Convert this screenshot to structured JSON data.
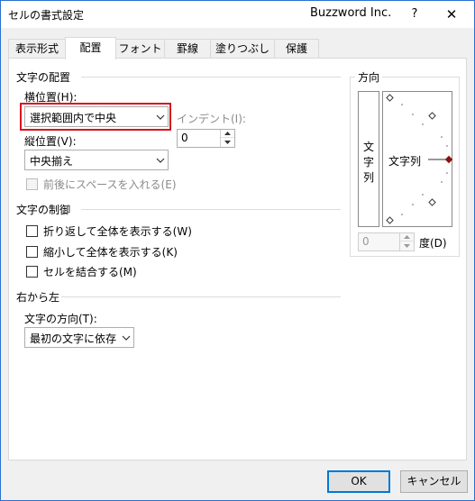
{
  "window": {
    "title": "セルの書式設定",
    "brand": "Buzzword Inc.",
    "help_label": "?",
    "close_label": "✕"
  },
  "tabs": [
    {
      "label": "表示形式",
      "active": false
    },
    {
      "label": "配置",
      "active": true
    },
    {
      "label": "フォント",
      "active": false
    },
    {
      "label": "罫線",
      "active": false
    },
    {
      "label": "塗りつぶし",
      "active": false
    },
    {
      "label": "保護",
      "active": false
    }
  ],
  "text_alignment": {
    "group_label": "文字の配置",
    "horizontal_label": "横位置(H):",
    "horizontal_value": "選択範囲内で中央",
    "indent_label": "インデント(I):",
    "indent_value": "0",
    "vertical_label": "縦位置(V):",
    "vertical_value": "中央揃え",
    "justify_distributed_label": "前後にスペースを入れる(E)"
  },
  "text_control": {
    "group_label": "文字の制御",
    "wrap_text_label": "折り返して全体を表示する(W)",
    "shrink_to_fit_label": "縮小して全体を表示する(K)",
    "merge_cells_label": "セルを結合する(M)"
  },
  "right_to_left": {
    "group_label": "右から左",
    "direction_label": "文字の方向(T):",
    "direction_value": "最初の文字に依存"
  },
  "orientation": {
    "group_label": "方向",
    "vertical_text_chars": [
      "文",
      "字",
      "列"
    ],
    "dial_text": "文字列",
    "degrees_value": "0",
    "degrees_label": "度(D)"
  },
  "footer": {
    "ok_label": "OK",
    "cancel_label": "キャンセル"
  },
  "colors": {
    "highlight": "#d9141c",
    "dial_marker": "#8b1010",
    "default_button_border": "#0078d7"
  }
}
